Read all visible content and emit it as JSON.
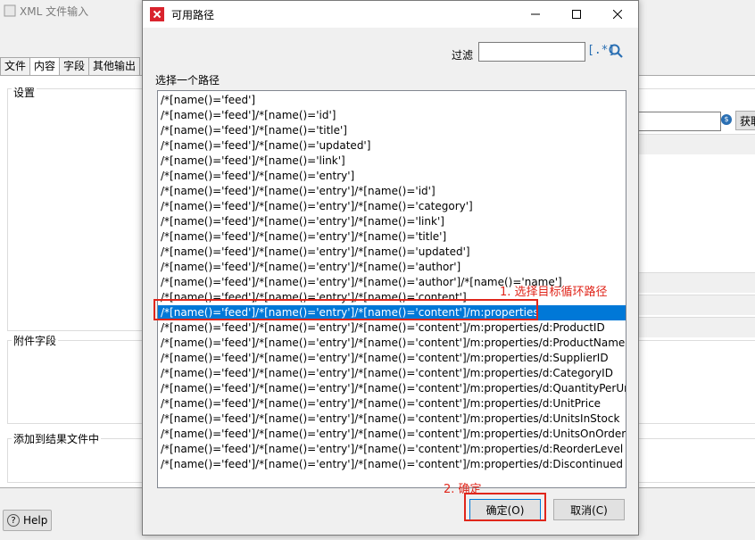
{
  "background": {
    "window_title": "XML 文件输入",
    "tabs": [
      "文件",
      "内容",
      "字段",
      "其他输出"
    ],
    "settings_group": "设置",
    "attach_group": "附件字段",
    "result_group": "添加到结果文件中",
    "fetch_label": "获取",
    "help_label": "Help"
  },
  "dialog": {
    "title": "可用路径",
    "filter_label": "过滤",
    "filter_value": "",
    "regex_icon": "[.*]",
    "list_label": "选择一个路径",
    "paths": [
      "/*[name()='feed']",
      "/*[name()='feed']/*[name()='id']",
      "/*[name()='feed']/*[name()='title']",
      "/*[name()='feed']/*[name()='updated']",
      "/*[name()='feed']/*[name()='link']",
      "/*[name()='feed']/*[name()='entry']",
      "/*[name()='feed']/*[name()='entry']/*[name()='id']",
      "/*[name()='feed']/*[name()='entry']/*[name()='category']",
      "/*[name()='feed']/*[name()='entry']/*[name()='link']",
      "/*[name()='feed']/*[name()='entry']/*[name()='title']",
      "/*[name()='feed']/*[name()='entry']/*[name()='updated']",
      "/*[name()='feed']/*[name()='entry']/*[name()='author']",
      "/*[name()='feed']/*[name()='entry']/*[name()='author']/*[name()='name']",
      "/*[name()='feed']/*[name()='entry']/*[name()='content']",
      "/*[name()='feed']/*[name()='entry']/*[name()='content']/m:properties",
      "/*[name()='feed']/*[name()='entry']/*[name()='content']/m:properties/d:ProductID",
      "/*[name()='feed']/*[name()='entry']/*[name()='content']/m:properties/d:ProductName",
      "/*[name()='feed']/*[name()='entry']/*[name()='content']/m:properties/d:SupplierID",
      "/*[name()='feed']/*[name()='entry']/*[name()='content']/m:properties/d:CategoryID",
      "/*[name()='feed']/*[name()='entry']/*[name()='content']/m:properties/d:QuantityPerUnit",
      "/*[name()='feed']/*[name()='entry']/*[name()='content']/m:properties/d:UnitPrice",
      "/*[name()='feed']/*[name()='entry']/*[name()='content']/m:properties/d:UnitsInStock",
      "/*[name()='feed']/*[name()='entry']/*[name()='content']/m:properties/d:UnitsOnOrder",
      "/*[name()='feed']/*[name()='entry']/*[name()='content']/m:properties/d:ReorderLevel",
      "/*[name()='feed']/*[name()='entry']/*[name()='content']/m:properties/d:Discontinued"
    ],
    "selected_index": 14,
    "ok_label": "确定(O)",
    "cancel_label": "取消(C)"
  },
  "annotations": {
    "step1": "1. 选择目标循环路径",
    "step2": "2. 确定"
  },
  "colors": {
    "selection": "#0078d7",
    "annotation": "#e0261b",
    "app_icon": "#d9232d"
  }
}
